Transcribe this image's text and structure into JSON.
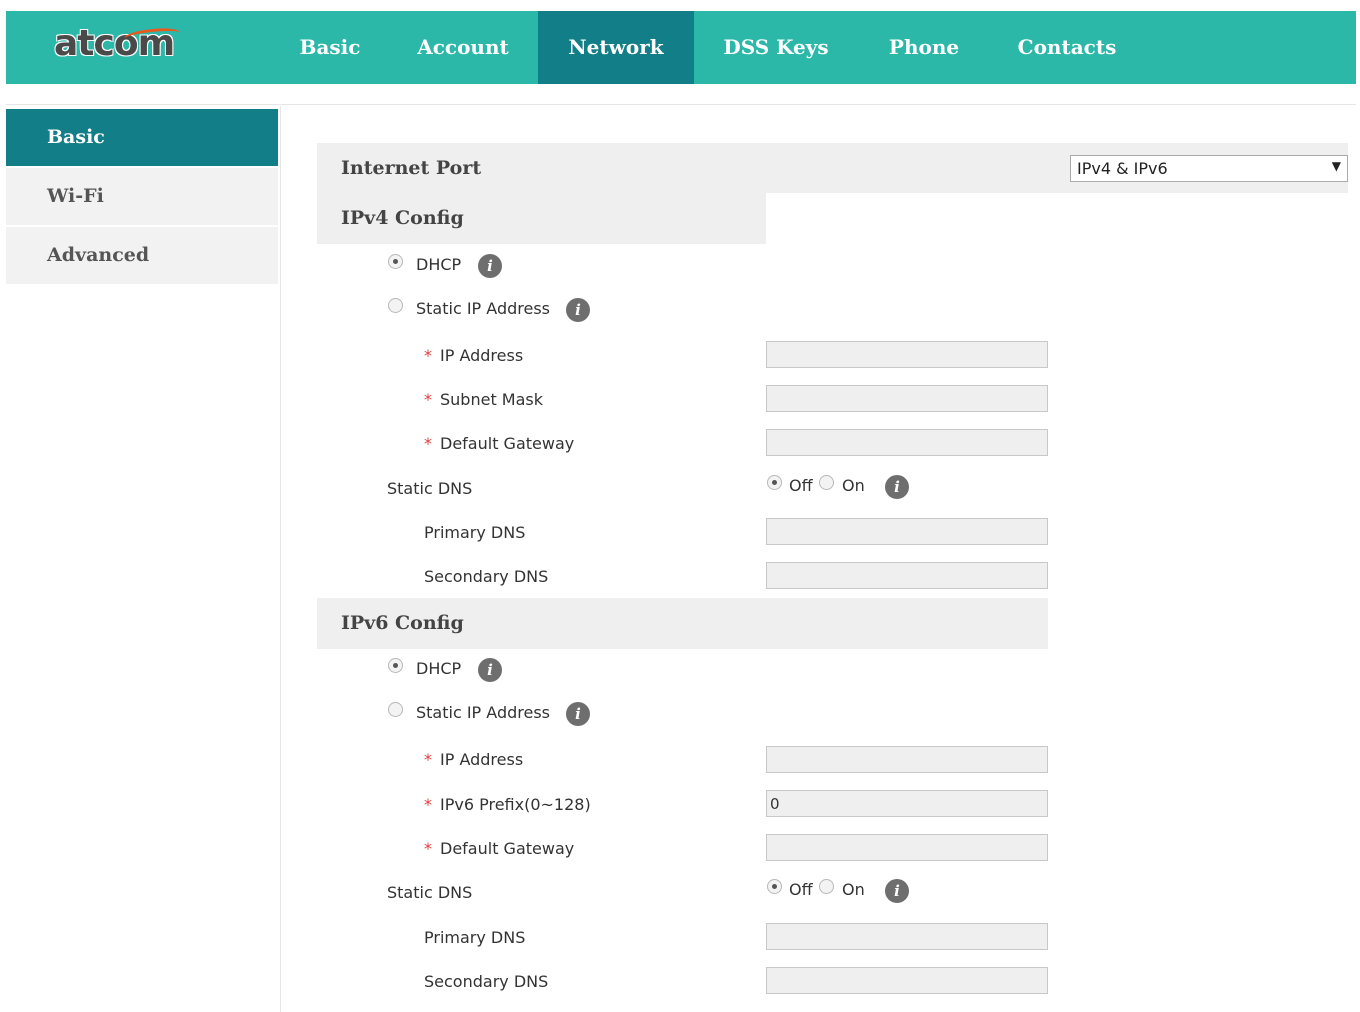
{
  "header": {
    "logo": "atcom",
    "tabs": [
      {
        "label": "Basic",
        "active": false
      },
      {
        "label": "Account",
        "active": false
      },
      {
        "label": "Network",
        "active": true
      },
      {
        "label": "DSS Keys",
        "active": false
      },
      {
        "label": "Phone",
        "active": false
      },
      {
        "label": "Contacts",
        "active": false
      }
    ]
  },
  "sidebar": {
    "items": [
      {
        "label": "Basic",
        "active": true
      },
      {
        "label": "Wi-Fi",
        "active": false
      },
      {
        "label": "Advanced",
        "active": false
      }
    ]
  },
  "internet_port": {
    "label": "Internet Port",
    "selected": "IPv4 & IPv6"
  },
  "ipv4": {
    "title": "IPv4 Config",
    "dhcp_label": "DHCP",
    "dhcp_checked": true,
    "static_label": "Static IP Address",
    "static_checked": false,
    "ip_label": "IP Address",
    "ip_value": "",
    "mask_label": "Subnet Mask",
    "mask_value": "",
    "gateway_label": "Default Gateway",
    "gateway_value": "",
    "static_dns_label": "Static DNS",
    "dns_off_label": "Off",
    "dns_on_label": "On",
    "dns_state": "off",
    "primary_dns_label": "Primary DNS",
    "primary_dns_value": "",
    "secondary_dns_label": "Secondary DNS",
    "secondary_dns_value": ""
  },
  "ipv6": {
    "title": "IPv6 Config",
    "dhcp_label": "DHCP",
    "dhcp_checked": true,
    "static_label": "Static IP Address",
    "static_checked": false,
    "ip_label": "IP Address",
    "ip_value": "",
    "prefix_label": "IPv6 Prefix(0~128)",
    "prefix_value": "0",
    "gateway_label": "Default Gateway",
    "gateway_value": "",
    "static_dns_label": "Static DNS",
    "dns_off_label": "Off",
    "dns_on_label": "On",
    "dns_state": "off",
    "primary_dns_label": "Primary DNS",
    "primary_dns_value": "",
    "secondary_dns_label": "Secondary DNS",
    "secondary_dns_value": ""
  },
  "required_mark": "*",
  "icons": {
    "info": "info-icon",
    "dropdown": "chevron-down-icon"
  },
  "colors": {
    "header": "#2cb8a9",
    "active": "#127e87",
    "required": "#e23b3b"
  }
}
